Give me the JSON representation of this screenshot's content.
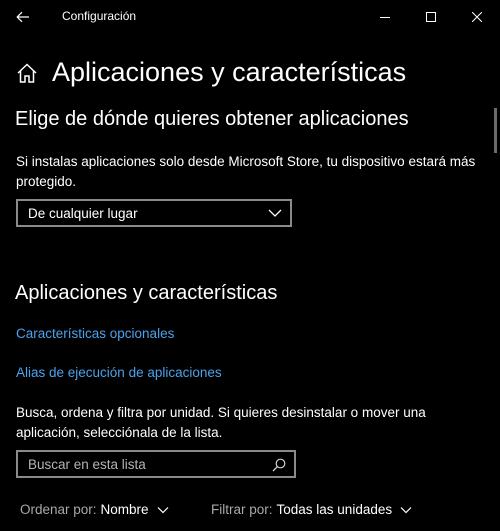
{
  "window": {
    "title": "Configuración",
    "controls": [
      "minimize",
      "maximize",
      "close"
    ]
  },
  "header": {
    "page_title": "Aplicaciones y características"
  },
  "source_section": {
    "heading": "Elige de dónde quieres obtener aplicaciones",
    "description": "Si instalas aplicaciones solo desde Microsoft Store, tu dispositivo estará más protegido.",
    "dropdown_value": "De cualquier lugar"
  },
  "apps_section": {
    "heading": "Aplicaciones y características",
    "links": [
      "Características opcionales",
      "Alias de ejecución de aplicaciones"
    ],
    "description": "Busca, ordena y filtra por unidad. Si quieres desinstalar o mover una aplicación, selecciónala de la lista.",
    "search_placeholder": "Buscar en esta lista",
    "sort_label": "Ordenar por:",
    "sort_value": "Nombre",
    "filter_label": "Filtrar por:",
    "filter_value": "Todas las unidades"
  },
  "colors": {
    "background": "#000000",
    "text": "#ffffff",
    "link": "#4aa3ec",
    "border": "#8a8a8a"
  },
  "icons": [
    "back-arrow-icon",
    "minimize-icon",
    "maximize-icon",
    "close-icon",
    "home-icon",
    "chevron-down-icon",
    "search-icon"
  ]
}
